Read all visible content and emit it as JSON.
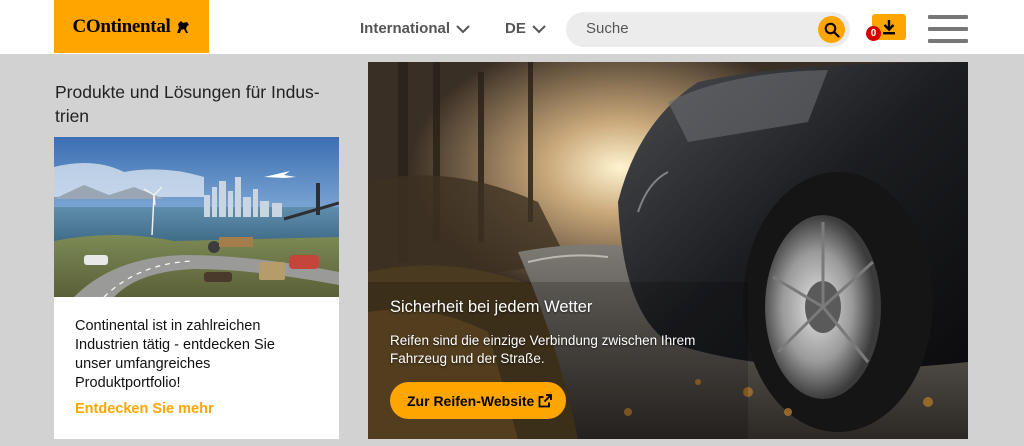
{
  "header": {
    "logo_text": "Ontinental",
    "logo_mark": "C",
    "region_label": "International",
    "language_label": "DE",
    "search": {
      "placeholder": "Suche"
    },
    "downloads_count": "0",
    "icons": {
      "search": "search-icon",
      "download": "download-icon",
      "menu": "hamburger-menu-icon",
      "chevron": "chevron-down-icon",
      "horse": "horse-logo-icon"
    }
  },
  "left": {
    "section_title": "Produkte und Lösungen für Indus-trien",
    "card": {
      "text": "Continental ist in zahlreichen Industrien tätig - entdecken Sie unser umfangreiches Produktportfolio!",
      "link_label": "Entdecken Sie mehr"
    }
  },
  "hero": {
    "title": "Sicherheit bei jedem Wetter",
    "text": "Reifen sind die einzige Verbindung zwischen Ihrem Fahrzeug und der Straße.",
    "button_label": "Zur Reifen-Website",
    "button_icon": "external-link-icon"
  },
  "colors": {
    "brand": "#ffa500",
    "page_bg": "#d2d2d2",
    "badge": "#d50000"
  }
}
